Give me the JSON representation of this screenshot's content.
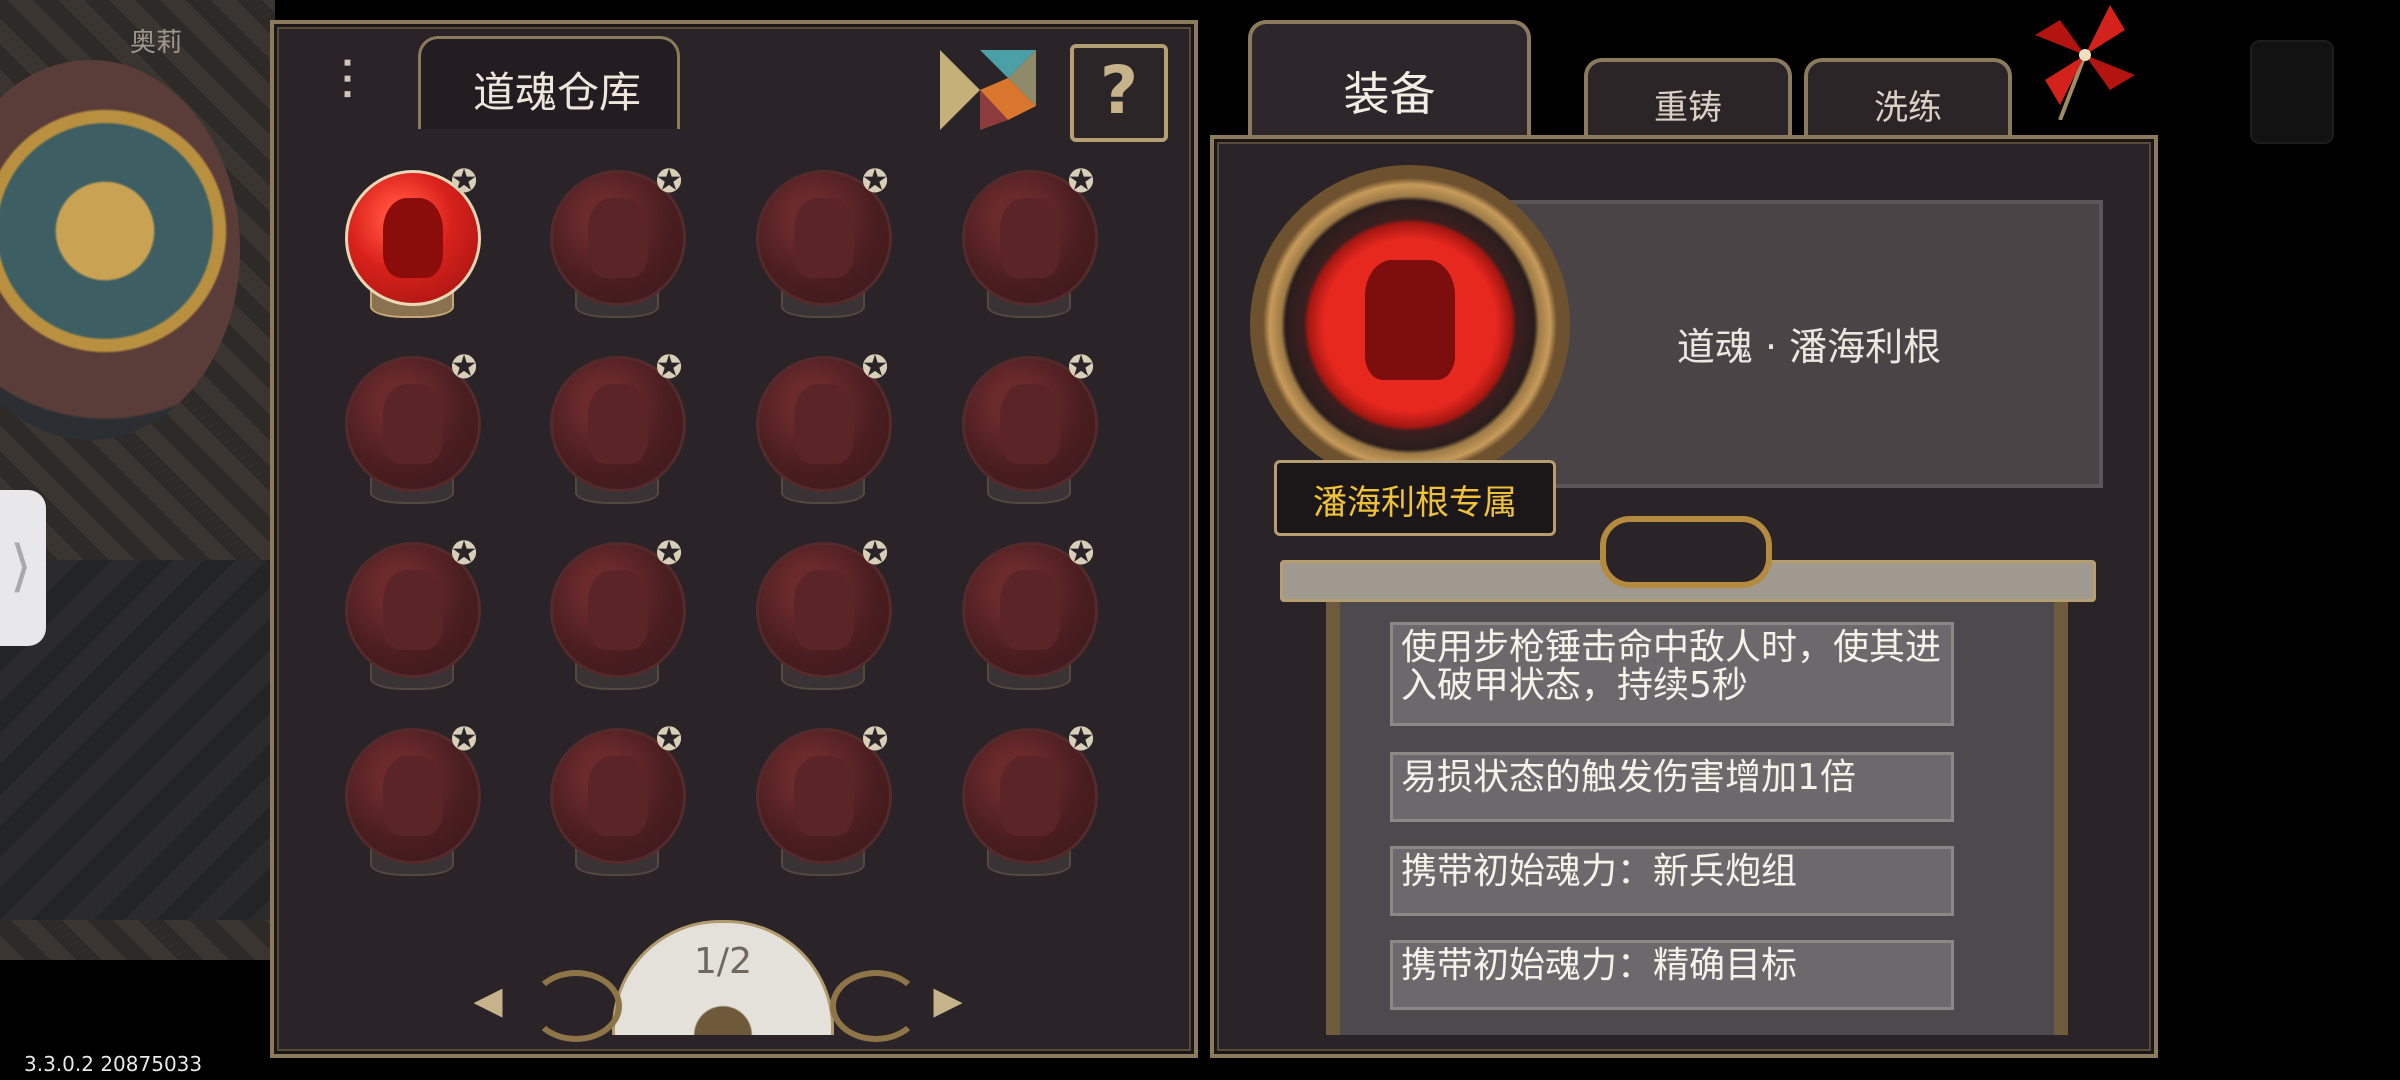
{
  "background": {
    "npc_name": "奥莉"
  },
  "storage": {
    "title": "道魂仓库",
    "help_label": "?",
    "page_indicator": "1/2",
    "prev_label": "◀",
    "next_label": "▶",
    "orbs": [
      {
        "id": "orb-1",
        "active": true
      },
      {
        "id": "orb-2",
        "active": false
      },
      {
        "id": "orb-3",
        "active": false
      },
      {
        "id": "orb-4",
        "active": false
      },
      {
        "id": "orb-5",
        "active": false
      },
      {
        "id": "orb-6",
        "active": false
      },
      {
        "id": "orb-7",
        "active": false
      },
      {
        "id": "orb-8",
        "active": false
      },
      {
        "id": "orb-9",
        "active": false
      },
      {
        "id": "orb-10",
        "active": false
      },
      {
        "id": "orb-11",
        "active": false
      },
      {
        "id": "orb-12",
        "active": false
      },
      {
        "id": "orb-13",
        "active": false
      },
      {
        "id": "orb-14",
        "active": false
      },
      {
        "id": "orb-15",
        "active": false
      },
      {
        "id": "orb-16",
        "active": false
      }
    ]
  },
  "tabs": {
    "equip": "装备",
    "recast": "重铸",
    "refine": "洗练"
  },
  "detail": {
    "name": "道魂 · 潘海利根",
    "exclusive_label": "潘海利根专属",
    "effects": [
      "使用步枪锤击命中敌人时，使其进入破甲状态，持续5秒",
      "易损状态的触发伤害增加1倍",
      "携带初始魂力：新兵炮组",
      "携带初始魂力：精确目标"
    ]
  },
  "colors": {
    "accent_gold": "#f0c23a",
    "orb_active": "#d8211b",
    "panel_bg": "#2a2327",
    "frame": "#8b7a5c"
  },
  "footer": {
    "version": "3.3.0.2 20875033"
  }
}
